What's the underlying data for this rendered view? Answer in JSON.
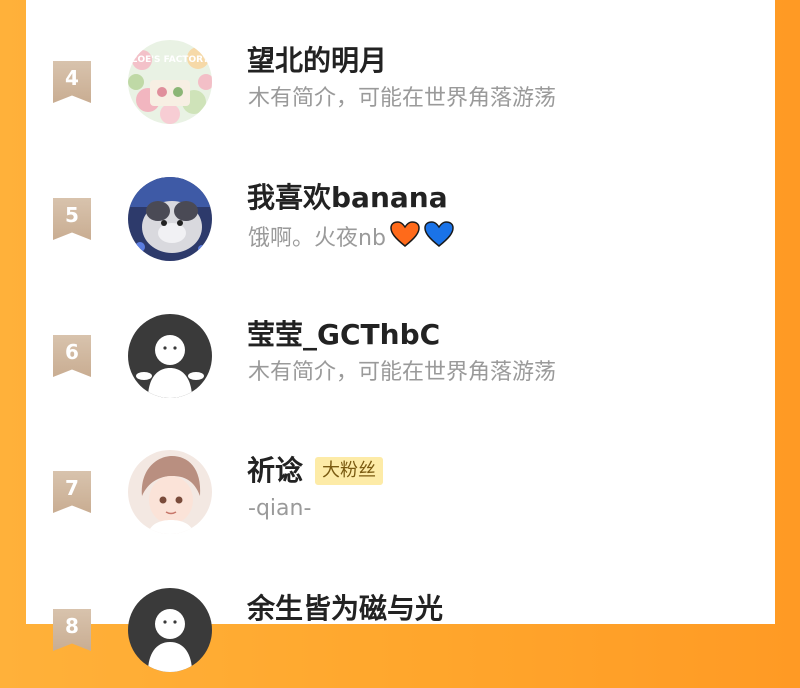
{
  "list": {
    "items": [
      {
        "rank": "4",
        "name": "望北的明月",
        "badge": "",
        "bio": "木有简介，可能在世界角落游荡",
        "avatar": "flower-garden-avatar",
        "avatar_text": "ZOE'S FACTORY"
      },
      {
        "rank": "5",
        "name": "我喜欢banana",
        "badge": "",
        "bio": "饿啊。火夜nb",
        "avatar": "cat-photo-avatar"
      },
      {
        "rank": "6",
        "name": "莹莹_GCThbC",
        "badge": "",
        "bio": "木有简介，可能在世界角落游荡",
        "avatar": "default-user-avatar"
      },
      {
        "rank": "7",
        "name": "祈谂",
        "badge": "大粉丝",
        "bio": "-qian-",
        "avatar": "anime-boy-avatar"
      },
      {
        "rank": "8",
        "name": "余生皆为磁与光",
        "badge": "",
        "bio": "",
        "avatar": "default-user-avatar"
      }
    ]
  },
  "colors": {
    "background_orange": "#ffa72d",
    "rank_ribbon": "#c9ad92",
    "badge_bg": "#fdeba7",
    "heart_orange": "#ff6a1a",
    "heart_blue": "#1a73e8"
  }
}
